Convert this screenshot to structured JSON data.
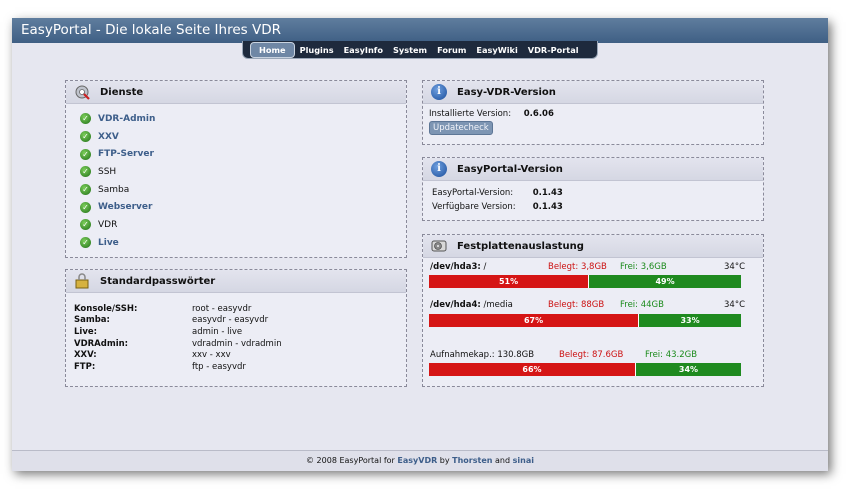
{
  "title": "EasyPortal - Die lokale Seite Ihres VDR",
  "nav": [
    "Home",
    "Plugins",
    "EasyInfo",
    "System",
    "Forum",
    "EasyWiki",
    "VDR-Portal"
  ],
  "dienste": {
    "title": "Dienste",
    "items": [
      {
        "label": "VDR-Admin",
        "link": true
      },
      {
        "label": "XXV",
        "link": true
      },
      {
        "label": "FTP-Server",
        "link": true
      },
      {
        "label": "SSH",
        "link": false
      },
      {
        "label": "Samba",
        "link": false
      },
      {
        "label": "Webserver",
        "link": true
      },
      {
        "label": "VDR",
        "link": false
      },
      {
        "label": "Live",
        "link": true
      }
    ]
  },
  "passwords": {
    "title": "Standardpasswörter",
    "rows": [
      {
        "k": "Konsole/SSH:",
        "v": "root - easyvdr"
      },
      {
        "k": "Samba:",
        "v": "easyvdr - easyvdr"
      },
      {
        "k": "Live:",
        "v": "admin - live"
      },
      {
        "k": "VDRAdmin:",
        "v": "vdradmin - vdradmin"
      },
      {
        "k": "XXV:",
        "v": "xxv - xxv"
      },
      {
        "k": "FTP:",
        "v": "ftp - easyvdr"
      }
    ]
  },
  "easyvdr": {
    "title": "Easy-VDR-Version",
    "installed_label": "Installierte Version:",
    "installed_value": "0.6.06",
    "button": "Updatecheck"
  },
  "easyportal": {
    "title": "EasyPortal-Version",
    "current_label": "EasyPortal-Version:",
    "current_value": "0.1.43",
    "available_label": "Verfügbare Version:",
    "available_value": "0.1.43"
  },
  "disks": {
    "title": "Festplattenauslastung",
    "items": [
      {
        "dev": "/dev/hda3:",
        "mount": "/",
        "used": "Belegt: 3,8GB",
        "free": "Frei: 3,6GB",
        "temp": "34°C",
        "used_pct": 51,
        "used_label": "51%",
        "free_label": "49%"
      },
      {
        "dev": "/dev/hda4:",
        "mount": "/media",
        "used": "Belegt: 88GB",
        "free": "Frei: 44GB",
        "temp": "34°C",
        "used_pct": 67,
        "used_label": "67%",
        "free_label": "33%"
      }
    ],
    "record": {
      "label": "Aufnahmekap.: 130.8GB",
      "used": "Belegt: 87.6GB",
      "free": "Frei: 43.2GB",
      "used_pct": 66,
      "used_label": "66%",
      "free_label": "34%"
    }
  },
  "footer": {
    "prefix": "© 2008 EasyPortal for",
    "easyvdr": "EasyVDR",
    "by": "by",
    "author1": "Thorsten",
    "and": "and",
    "author2": "sinai"
  }
}
